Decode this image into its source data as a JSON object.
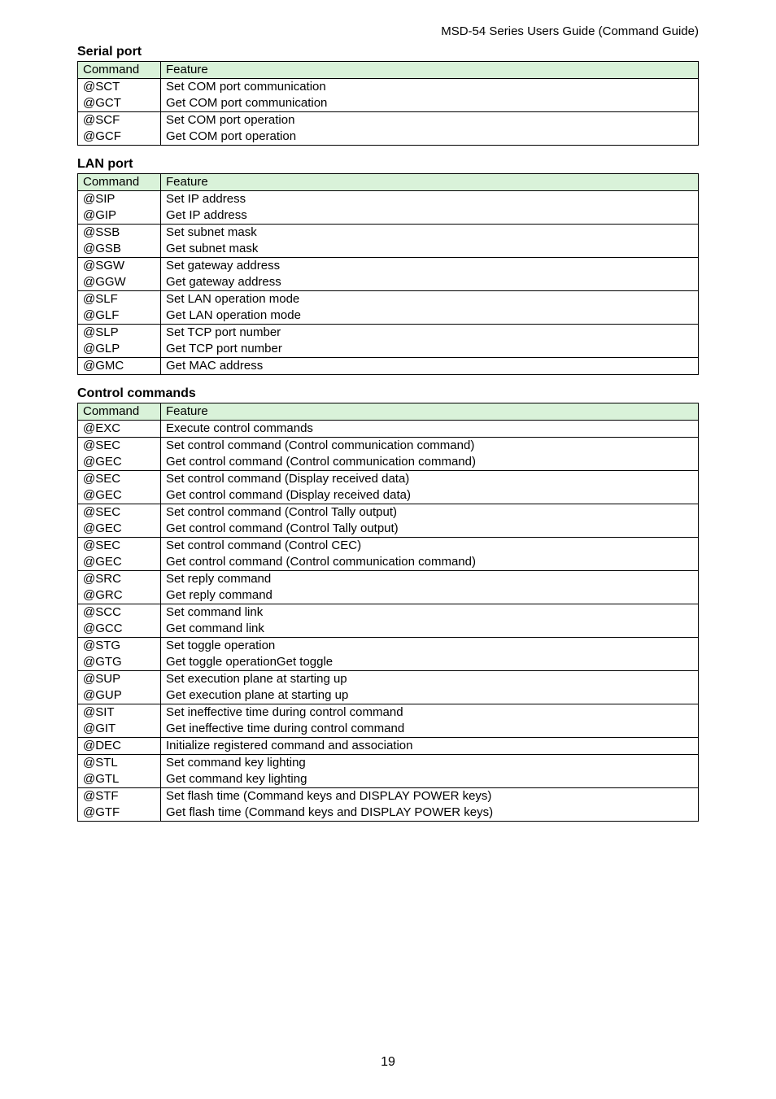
{
  "docTitle": "MSD-54 Series Users Guide (Command Guide)",
  "pageNumber": "19",
  "tableHeader": {
    "command": "Command",
    "feature": "Feature"
  },
  "serialPort": {
    "heading": "Serial port",
    "rows": [
      [
        "@SCT",
        "Set COM port communication"
      ],
      [
        "@GCT",
        "Get COM port communication"
      ],
      [
        "@SCF",
        "Set COM port operation"
      ],
      [
        "@GCF",
        "Get COM port operation"
      ]
    ],
    "groups": [
      2,
      2
    ]
  },
  "lanPort": {
    "heading": "LAN port",
    "rows": [
      [
        "@SIP",
        "Set IP address"
      ],
      [
        "@GIP",
        "Get IP address"
      ],
      [
        "@SSB",
        "Set subnet mask"
      ],
      [
        "@GSB",
        "Get subnet mask"
      ],
      [
        "@SGW",
        "Set gateway address"
      ],
      [
        "@GGW",
        "Get gateway address"
      ],
      [
        "@SLF",
        "Set LAN operation mode"
      ],
      [
        "@GLF",
        "Get LAN operation mode"
      ],
      [
        "@SLP",
        "Set TCP port number"
      ],
      [
        "@GLP",
        "Get TCP port number"
      ],
      [
        "@GMC",
        "Get MAC address"
      ]
    ],
    "groups": [
      2,
      2,
      2,
      2,
      2,
      1
    ]
  },
  "controlCommands": {
    "heading": "Control commands",
    "rows": [
      [
        "@EXC",
        "Execute control commands"
      ],
      [
        "@SEC",
        "Set control command (Control communication command)"
      ],
      [
        "@GEC",
        "Get control command (Control communication command)"
      ],
      [
        "@SEC",
        "Set control command (Display received data)"
      ],
      [
        "@GEC",
        "Get control command (Display received data)"
      ],
      [
        "@SEC",
        "Set control command (Control Tally output)"
      ],
      [
        "@GEC",
        "Get control command (Control Tally output)"
      ],
      [
        "@SEC",
        "Set control command (Control CEC)"
      ],
      [
        "@GEC",
        "Get control command (Control communication command)"
      ],
      [
        "@SRC",
        "Set reply command"
      ],
      [
        "@GRC",
        "Get reply command"
      ],
      [
        "@SCC",
        "Set command link"
      ],
      [
        "@GCC",
        "Get command link"
      ],
      [
        "@STG",
        "Set toggle operation"
      ],
      [
        "@GTG",
        "Get toggle operationGet toggle"
      ],
      [
        "@SUP",
        "Set execution plane at starting up"
      ],
      [
        "@GUP",
        "Get execution plane at starting up"
      ],
      [
        "@SIT",
        "Set ineffective time during control command"
      ],
      [
        "@GIT",
        "Get ineffective time during control command"
      ],
      [
        "@DEC",
        "Initialize registered command and association"
      ],
      [
        "@STL",
        "Set command key lighting"
      ],
      [
        "@GTL",
        "Get command key lighting"
      ],
      [
        "@STF",
        "Set flash time (Command keys and DISPLAY POWER keys)"
      ],
      [
        "@GTF",
        "Get flash time (Command keys and DISPLAY POWER keys)"
      ]
    ],
    "groups": [
      1,
      2,
      2,
      2,
      2,
      2,
      2,
      2,
      2,
      2,
      1,
      2,
      2
    ]
  }
}
